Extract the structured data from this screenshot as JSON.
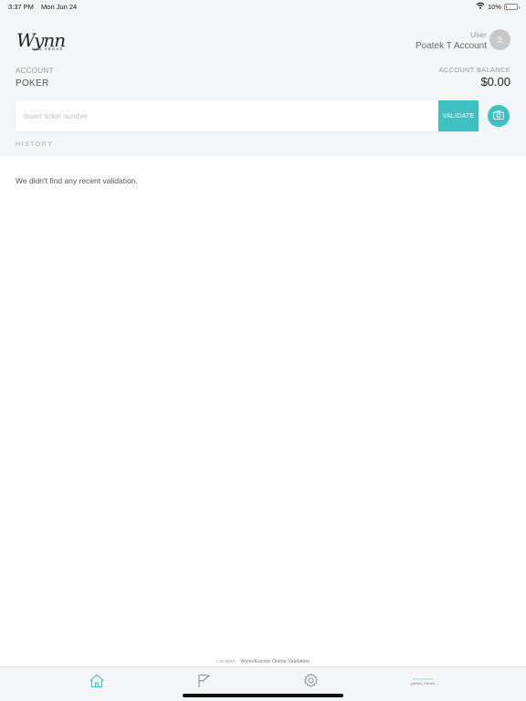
{
  "status_bar": {
    "time": "3:37 PM",
    "date": "Mon Jun 24",
    "battery_text": "10%",
    "battery_level": 0.1,
    "wifi_icon": "wifi-icon"
  },
  "header": {
    "logo_script": "Wynn",
    "logo_sub": "LAS VEGAS",
    "user_label": "User",
    "user_name": "Poatek T Account",
    "account_label": "ACCOUNT",
    "account_name": "POKER",
    "balance_label": "ACCOUNT BALANCE",
    "balance_value": "$0.00"
  },
  "ticket": {
    "placeholder": "Insert ticket number",
    "value": "",
    "validate_label": "VALIDATE"
  },
  "history": {
    "label": "HISTORY",
    "empty_message": "We didn't find any recent validation."
  },
  "footer": {
    "location_label": "Location",
    "location_value": "Wynn/Encore Online Validation",
    "tabs": [
      "home-icon",
      "flag-icon",
      "gear-icon",
      "wynn-logo-icon"
    ]
  },
  "colors": {
    "accent": "#3ec1c3",
    "header_bg": "#f4f5f7",
    "battery_low": "#e53935"
  }
}
